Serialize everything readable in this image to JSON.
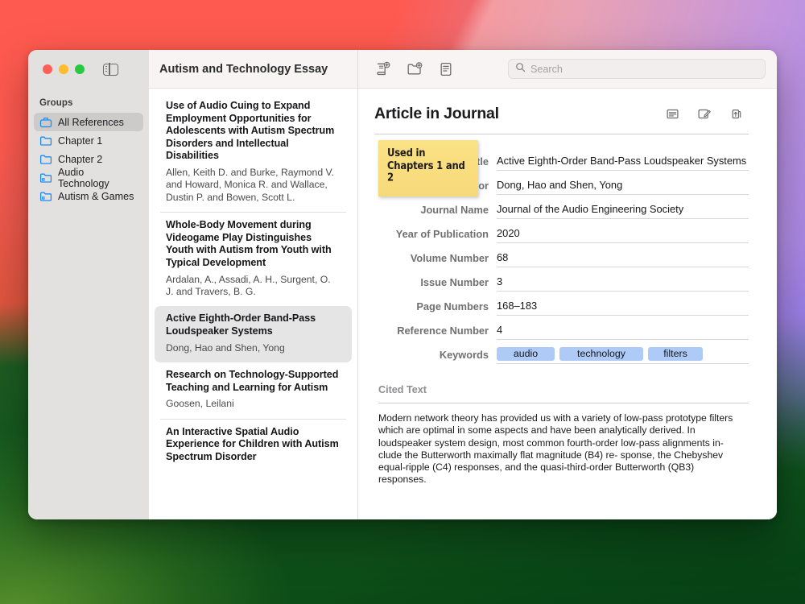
{
  "window": {
    "title": "Autism and Technology Essay",
    "traffic_lights": [
      "close",
      "minimize",
      "maximize"
    ],
    "sidebar_toggle_icon": "sidebar-toggle-icon"
  },
  "toolbar": {
    "new_reference_icon": "new-reference-icon",
    "new_group_icon": "new-group-icon",
    "notes_icon": "notes-icon",
    "search": {
      "icon": "search-icon",
      "placeholder": "Search",
      "value": ""
    }
  },
  "sidebar": {
    "header": "Groups",
    "items": [
      {
        "label": "All References",
        "icon": "all-references-icon",
        "selected": true
      },
      {
        "label": "Chapter 1",
        "icon": "folder-icon",
        "selected": false
      },
      {
        "label": "Chapter 2",
        "icon": "folder-icon",
        "selected": false
      },
      {
        "label": "Audio Technology",
        "icon": "smart-folder-icon",
        "selected": false
      },
      {
        "label": "Autism & Games",
        "icon": "smart-folder-icon",
        "selected": false
      }
    ]
  },
  "reference_list": [
    {
      "title": "Use of Audio Cuing to Expand Employment Opportunities for Adolescents with Autism Spectrum Disorders and Intellectual Disabilities",
      "authors": "Allen, Keith D. and Burke, Raymond V. and Howard, Monica R. and Wallace, Dustin P. and Bowen, Scott L.",
      "selected": false
    },
    {
      "title": "Whole-Body Movement during Videogame Play Distinguishes Youth with Autism from Youth with Typical Development",
      "authors": "Ardalan, A., Assadi, A. H., Surgent, O. J. and Travers, B. G.",
      "selected": false
    },
    {
      "title": "Active Eighth-Order Band-Pass Loudspeaker Systems",
      "authors": "Dong, Hao and Shen, Yong",
      "selected": true
    },
    {
      "title": "Research on Technology-Supported Teaching and Learning for Autism",
      "authors": "Goosen, Leilani",
      "selected": false
    },
    {
      "title": "An Interactive Spatial Audio Experience for Children with Autism Spectrum Disorder",
      "authors": "",
      "selected": false
    }
  ],
  "detail": {
    "title": "Article in Journal",
    "header_icons": [
      {
        "name": "text-view-icon"
      },
      {
        "name": "annotate-icon"
      },
      {
        "name": "share-icon"
      }
    ],
    "sticky_note": "Used in Chapters 1 and 2",
    "fields": [
      {
        "label": "Article Title",
        "value": "Active Eighth-Order Band-Pass Loudspeaker Systems"
      },
      {
        "label": "Author",
        "value": "Dong, Hao and Shen, Yong"
      },
      {
        "label": "Journal Name",
        "value": "Journal of the Audio Engineering Society"
      },
      {
        "label": "Year of Publication",
        "value": "2020"
      },
      {
        "label": "Volume Number",
        "value": "68"
      },
      {
        "label": "Issue Number",
        "value": "3"
      },
      {
        "label": "Page Numbers",
        "value": "168–183"
      },
      {
        "label": "Reference Number",
        "value": "4"
      }
    ],
    "keywords_label": "Keywords",
    "keywords": [
      "audio",
      "technology",
      "filters"
    ],
    "cited_text_label": "Cited Text",
    "cited_text": "Modern network theory has provided us with a variety of low-pass prototype filters which are optimal in some aspects and have been analytically derived. In loudspeaker system design, most common fourth-order low-pass alignments in- clude the Butterworth maximally flat magnitude (B4) re- sponse, the Chebyshev equal-ripple (C4) responses, and the quasi-third-order Butterworth (QB3) responses."
  },
  "colors": {
    "accent_blue": "#1a8cf5",
    "token_blue": "#aecbf7",
    "sticky_yellow": "#f9dd7e",
    "sidebar_bg": "#e3e1e0",
    "toolbar_bg": "#f7f4f3"
  }
}
